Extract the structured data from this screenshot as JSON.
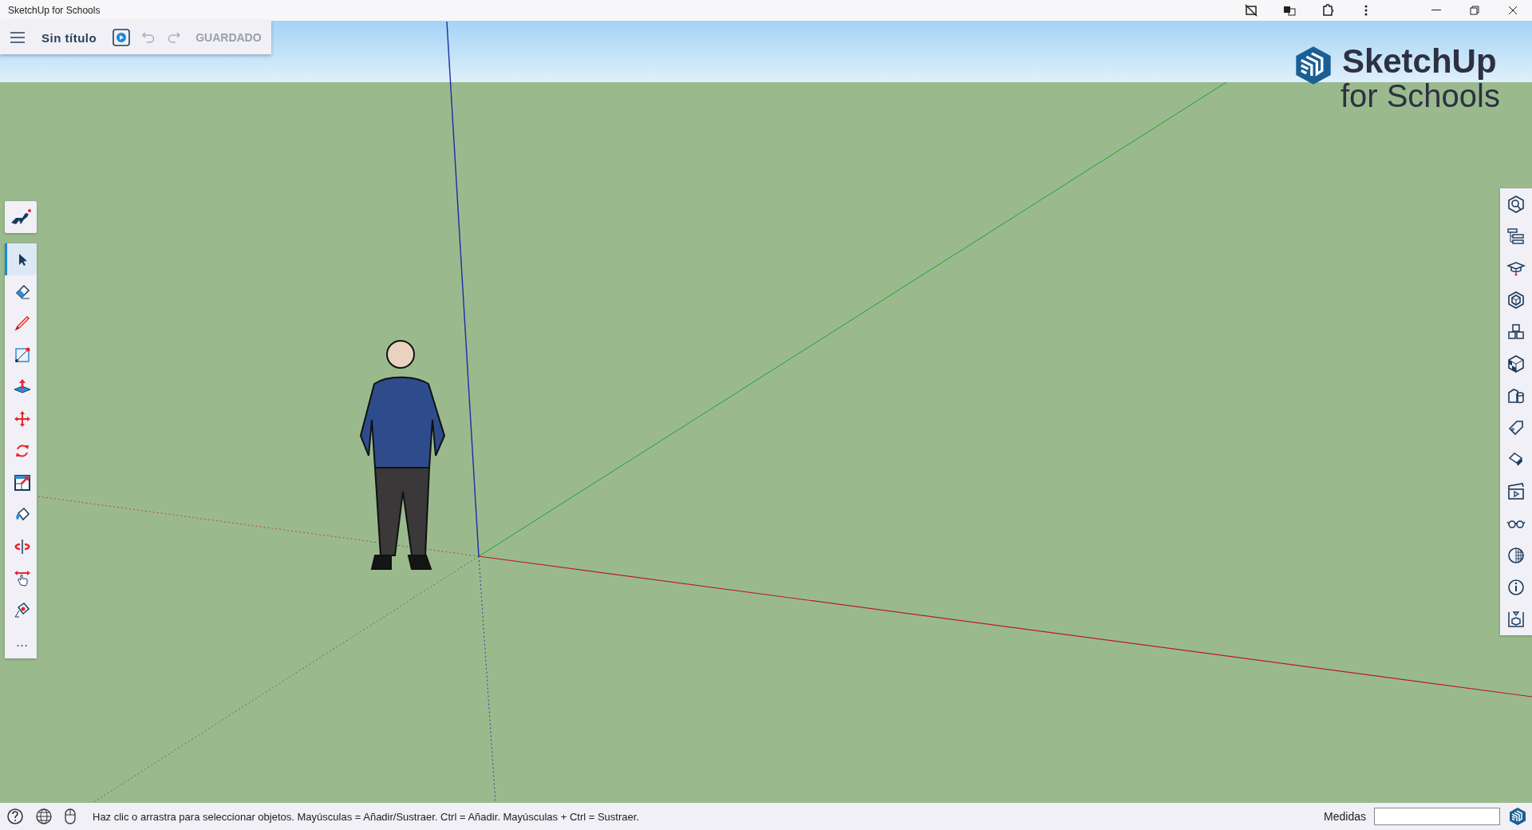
{
  "window": {
    "title": "SketchUp for Schools"
  },
  "toolbar": {
    "title": "Sin título",
    "undo": {
      "disabled": true
    },
    "redo": {
      "disabled": true
    },
    "save_status": "GUARDADO"
  },
  "logo": {
    "name": "SketchUp",
    "subtitle": "for Schools"
  },
  "tools": [
    {
      "kind": "select",
      "selected": true
    },
    {
      "kind": "eraser",
      "selected": false
    },
    {
      "kind": "pencil",
      "selected": false
    },
    {
      "kind": "rectangle",
      "selected": false
    },
    {
      "kind": "pushpull",
      "selected": false
    },
    {
      "kind": "move",
      "selected": false
    },
    {
      "kind": "rotate",
      "selected": false
    },
    {
      "kind": "scale",
      "selected": false
    },
    {
      "kind": "paint",
      "selected": false
    },
    {
      "kind": "orbit",
      "selected": false
    },
    {
      "kind": "pan",
      "selected": false
    },
    {
      "kind": "tape",
      "selected": false
    },
    {
      "kind": "more",
      "label": "…",
      "selected": false
    }
  ],
  "status_bar": {
    "hint": "Haz clic o arrastra para seleccionar objetos. Mayúsculas = Añadir/Sustraer. Ctrl = Añadir. Mayúsculas + Ctrl = Sustraer.",
    "measurements_label": "Medidas"
  }
}
